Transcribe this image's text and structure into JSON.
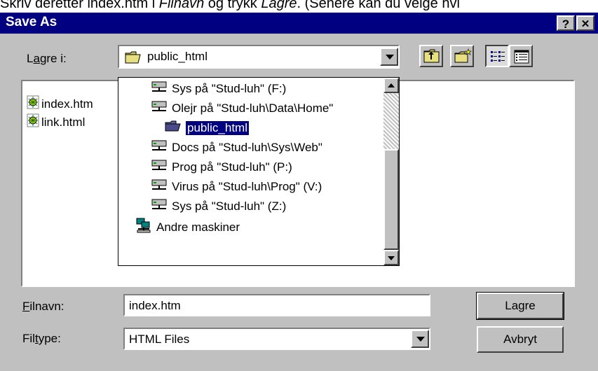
{
  "instruction": {
    "part1": "Skriv deretter index.htm i ",
    "em1": "Filnavn",
    "part2": " og trykk ",
    "em2": "Lagre",
    "part3": ". (Senere kan du velge hvi"
  },
  "dialog": {
    "title": "Save As",
    "help_button": "?",
    "close_button": "✕"
  },
  "save_in": {
    "label_accel": "a",
    "label_pre": "L",
    "label_post": "gre i:",
    "value": "public_html"
  },
  "files": [
    {
      "name": "index.htm",
      "icon": "web-document-icon"
    },
    {
      "name": "link.html",
      "icon": "web-document-icon"
    }
  ],
  "dropdown_items": [
    {
      "label": "Sys på \"Stud-luh\" (F:)",
      "icon": "network-drive-icon",
      "selected": false
    },
    {
      "label": "Olejr på \"Stud-luh\\Data\\Home\"",
      "icon": "network-drive-icon",
      "selected": false
    },
    {
      "label": "public_html",
      "icon": "open-folder-icon",
      "selected": true
    },
    {
      "label": "Docs på \"Stud-luh\\Sys\\Web\"",
      "icon": "network-drive-icon",
      "selected": false
    },
    {
      "label": "Prog på \"Stud-luh\" (P:)",
      "icon": "network-drive-icon",
      "selected": false
    },
    {
      "label": "Virus på \"Stud-luh\\Prog\" (V:)",
      "icon": "network-drive-icon",
      "selected": false
    },
    {
      "label": "Sys på \"Stud-luh\" (Z:)",
      "icon": "network-drive-icon",
      "selected": false
    },
    {
      "label": "Andre maskiner",
      "icon": "network-neighborhood-icon",
      "selected": false
    }
  ],
  "filename": {
    "label_accel": "F",
    "label_post": "ilnavn:",
    "value": "index.htm"
  },
  "filetype": {
    "label_pre": "Fil",
    "label_accel": "t",
    "label_post": "ype:",
    "value": "HTML Files"
  },
  "buttons": {
    "save": "Lagre",
    "cancel": "Avbryt"
  },
  "colors": {
    "titlebar": "#000080",
    "face": "#c0c0c0",
    "selection": "#000080"
  }
}
